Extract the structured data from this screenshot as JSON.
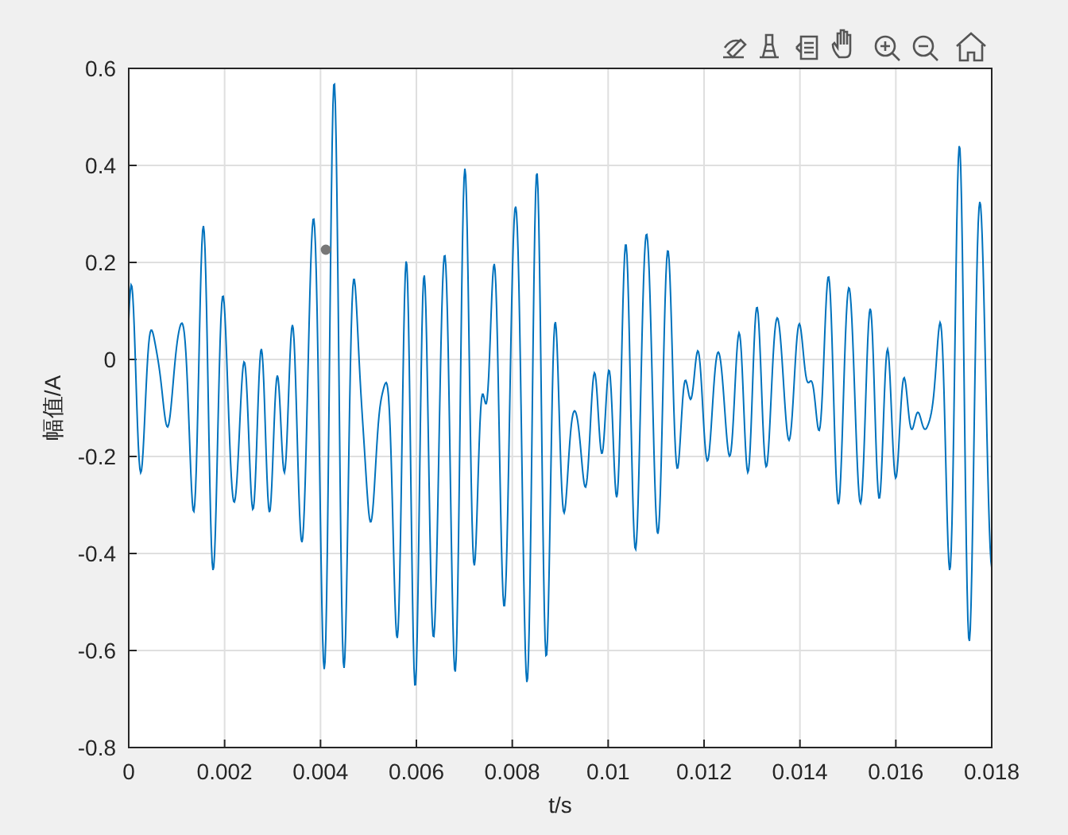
{
  "axes": {
    "xlabel": "t/s",
    "ylabel": "幅值/A",
    "xticks": [
      "0",
      "0.002",
      "0.004",
      "0.006",
      "0.008",
      "0.01",
      "0.012",
      "0.014",
      "0.016",
      "0.018"
    ],
    "yticks": [
      "0.6",
      "0.4",
      "0.2",
      "0",
      "-0.2",
      "-0.4",
      "-0.6",
      "-0.8"
    ]
  }
}
